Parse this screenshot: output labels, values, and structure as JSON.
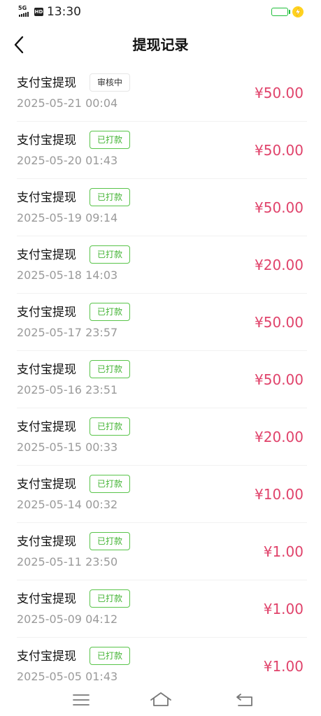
{
  "status_bar": {
    "network": "5G",
    "hd": "HD",
    "time": "13:30",
    "battery_level": 1.0,
    "charging": true
  },
  "header": {
    "title": "提现记录",
    "back_icon": "chevron-left-icon"
  },
  "records": [
    {
      "title": "支付宝提现",
      "status": "审核中",
      "date": "2025-05-21 00:04",
      "amount": "¥50.00"
    },
    {
      "title": "支付宝提现",
      "status": "已打款",
      "date": "2025-05-20 01:43",
      "amount": "¥50.00"
    },
    {
      "title": "支付宝提现",
      "status": "已打款",
      "date": "2025-05-19 09:14",
      "amount": "¥50.00"
    },
    {
      "title": "支付宝提现",
      "status": "已打款",
      "date": "2025-05-18 14:03",
      "amount": "¥20.00"
    },
    {
      "title": "支付宝提现",
      "status": "已打款",
      "date": "2025-05-17 23:57",
      "amount": "¥50.00"
    },
    {
      "title": "支付宝提现",
      "status": "已打款",
      "date": "2025-05-16 23:51",
      "amount": "¥50.00"
    },
    {
      "title": "支付宝提现",
      "status": "已打款",
      "date": "2025-05-15 00:33",
      "amount": "¥20.00"
    },
    {
      "title": "支付宝提现",
      "status": "已打款",
      "date": "2025-05-14 00:32",
      "amount": "¥10.00"
    },
    {
      "title": "支付宝提现",
      "status": "已打款",
      "date": "2025-05-11 23:50",
      "amount": "¥1.00"
    },
    {
      "title": "支付宝提现",
      "status": "已打款",
      "date": "2025-05-09 04:12",
      "amount": "¥1.00"
    },
    {
      "title": "支付宝提现",
      "status": "已打款",
      "date": "2025-05-05 01:43",
      "amount": "¥1.00"
    }
  ],
  "colors": {
    "amount": "#e0436b",
    "paid_badge": "#44b435",
    "battery": "#1fbf3a"
  },
  "nav_bar": {
    "icons": [
      "menu-icon",
      "home-icon",
      "back-icon"
    ]
  }
}
